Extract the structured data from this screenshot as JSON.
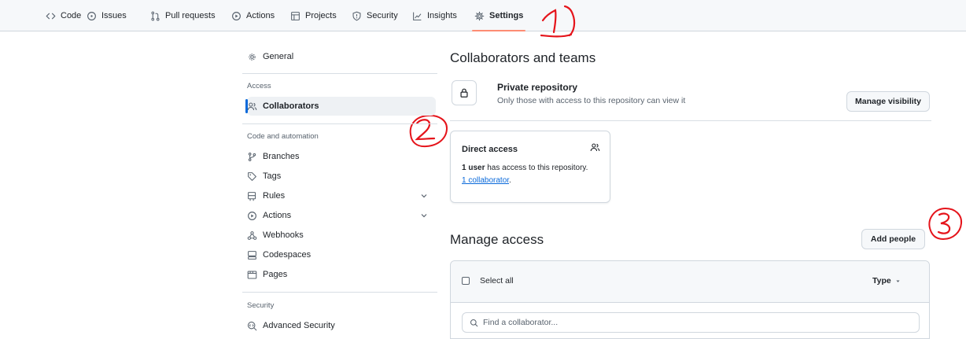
{
  "repo_nav": {
    "tabs": [
      {
        "label": "Code",
        "icon": "code-icon"
      },
      {
        "label": "Issues",
        "icon": "issue-icon"
      },
      {
        "label": "Pull requests",
        "icon": "pull-request-icon"
      },
      {
        "label": "Actions",
        "icon": "play-icon"
      },
      {
        "label": "Projects",
        "icon": "table-icon"
      },
      {
        "label": "Security",
        "icon": "shield-icon"
      },
      {
        "label": "Insights",
        "icon": "graph-icon"
      },
      {
        "label": "Settings",
        "icon": "gear-icon",
        "active": true
      }
    ],
    "active_underline_color": "#fd8c73"
  },
  "annotations": {
    "color": "#e5141b",
    "marks": [
      "1",
      "2",
      "3"
    ]
  },
  "sidebar": {
    "general": {
      "label": "General",
      "icon": "gear-icon"
    },
    "access_heading": "Access",
    "collaborators": {
      "label": "Collaborators",
      "icon": "people-icon",
      "selected": true
    },
    "code_heading": "Code and automation",
    "items": [
      {
        "label": "Branches",
        "icon": "branch-icon"
      },
      {
        "label": "Tags",
        "icon": "tag-icon"
      },
      {
        "label": "Rules",
        "icon": "rules-icon",
        "expandable": true
      },
      {
        "label": "Actions",
        "icon": "play-icon",
        "expandable": true
      },
      {
        "label": "Webhooks",
        "icon": "webhook-icon"
      },
      {
        "label": "Codespaces",
        "icon": "codespaces-icon"
      },
      {
        "label": "Pages",
        "icon": "browser-icon"
      }
    ],
    "security_heading": "Security",
    "advanced_security": {
      "label": "Advanced Security",
      "icon": "codescan-icon"
    },
    "selection_color": "#0969da"
  },
  "main": {
    "title": "Collaborators and teams",
    "visibility": {
      "title": "Private repository",
      "description": "Only those with access to this repository can view it",
      "button": "Manage visibility",
      "icon": "lock-icon"
    },
    "direct_access": {
      "title": "Direct access",
      "count_bold": "1 user",
      "count_rest": " has access to this repository.",
      "link": "1 collaborator",
      "link_suffix": ".",
      "icon": "people-icon"
    },
    "manage_access": {
      "title": "Manage access",
      "add_button": "Add people",
      "select_all": "Select all",
      "type_filter": "Type",
      "search_placeholder": "Find a collaborator..."
    }
  }
}
